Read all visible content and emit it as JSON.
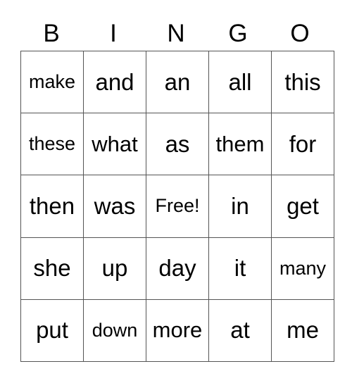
{
  "header": [
    "B",
    "I",
    "N",
    "G",
    "O"
  ],
  "rows": [
    [
      "make",
      "and",
      "an",
      "all",
      "this"
    ],
    [
      "these",
      "what",
      "as",
      "them",
      "for"
    ],
    [
      "then",
      "was",
      "Free!",
      "in",
      "get"
    ],
    [
      "she",
      "up",
      "day",
      "it",
      "many"
    ],
    [
      "put",
      "down",
      "more",
      "at",
      "me"
    ]
  ]
}
